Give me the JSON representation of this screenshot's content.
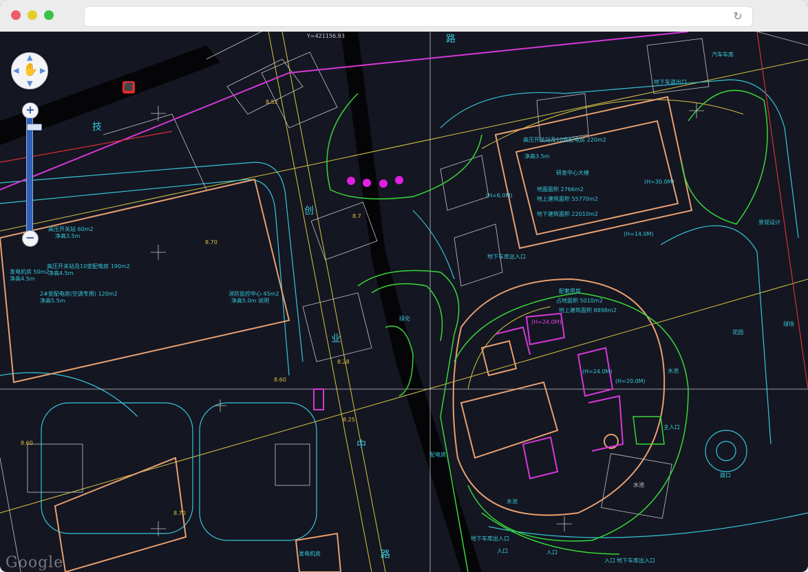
{
  "window": {
    "traffic_lights": [
      "close",
      "minimize",
      "zoom"
    ],
    "url": "",
    "reload_icon": "reload-icon"
  },
  "map": {
    "background": "#141622",
    "colors": {
      "cyan": "#36c8d8",
      "white": "#c8c8c8",
      "yellow": "#d8c840",
      "green": "#38d838",
      "magenta": "#d838d8",
      "orange": "#e8a070",
      "red": "#d83030"
    },
    "controls": {
      "pan_icon": "hand-pan-icon",
      "zoom_in": "+",
      "zoom_out": "−",
      "zoom_level_fraction": 0.05
    },
    "watermark": "Google",
    "road_labels": [
      "路",
      "技",
      "创",
      "业",
      "中",
      "路"
    ],
    "labels": {
      "coord": "Y=421156.93",
      "b1_l1": "高压开关站 60m2",
      "b1_l2": "净高3.5m",
      "b1_l3": "高压开关站及10变配电房 190m2",
      "b1_l4": "净高4.5m",
      "b1_l5": "发电机房 50m2",
      "b1_l6": "净高4.5m",
      "b1_l7": "2#变配电房(空调专用) 120m2",
      "b1_l8": "净高5.5m",
      "b1_l9": "消防监控中心 45m2",
      "b1_l10": "净高5.0m 说明",
      "r1": "高压开关站及10变配电房 220m2",
      "r2": "净高3.5m",
      "r3": "研发中心大楼",
      "r4": "地面面积 2766m2",
      "r5": "地上建筑面积 55770m2",
      "r6": "地下建筑面积 22010m2",
      "h1": "(H=30.0M)",
      "h2": "(H=14.0M)",
      "h3": "(H=6.0M)",
      "h4": "(H=24.0M)",
      "h5": "(H=24.0M)",
      "h6": "(H=20.0M)",
      "c1": "配套用房",
      "c2": "占地面积 5010m2",
      "c3": "地上建筑面积 8898m2",
      "n1": "地下车道出口",
      "n2": "水池",
      "n3": "水池",
      "n4": "水池",
      "n5": "主入口",
      "n6": "入口",
      "n7": "入口",
      "n8": "地下车库出入口",
      "n9": "景观设计",
      "n10": "路口",
      "n11": "球场",
      "n12": "花园",
      "n13": "汽车车库",
      "n14": "地下车库出入口",
      "n15": "入口",
      "n16": "地下车库出入口",
      "n17": "配电房",
      "n18": "发电机房",
      "n19": "绿化",
      "e1": "8.70",
      "e2": "8.70",
      "e3": "8.60",
      "e4": "8.28",
      "e5": "8.25",
      "e6": "8.60",
      "e7": "8.52",
      "e8": "8.7"
    }
  }
}
